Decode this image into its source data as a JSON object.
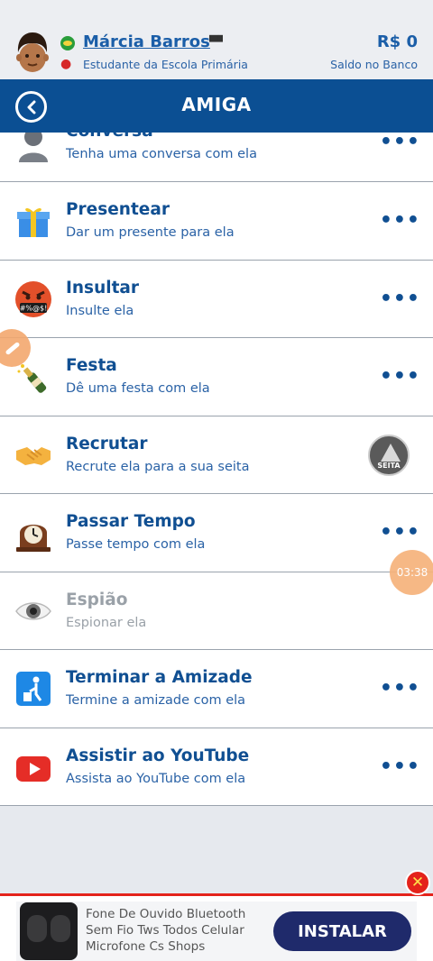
{
  "header": {
    "name": "Márcia Barros",
    "role": "Estudante da Escola Primária",
    "money": "R$ 0",
    "money_label": "Saldo no Banco"
  },
  "titlebar": {
    "title": "AMIGA"
  },
  "items": [
    {
      "title": "Conversa",
      "subtitle": "Tenha uma conversa com ela",
      "icon": "person-silhouette-icon",
      "more": "•••"
    },
    {
      "title": "Presentear",
      "subtitle": "Dar um presente para ela",
      "icon": "gift-icon",
      "more": "•••"
    },
    {
      "title": "Insultar",
      "subtitle": "Insulte ela",
      "icon": "angry-face-icon",
      "more": "•••"
    },
    {
      "title": "Festa",
      "subtitle": "Dê uma festa com ela",
      "icon": "champagne-icon",
      "more": "•••"
    },
    {
      "title": "Recrutar",
      "subtitle": "Recrute ela para a sua seita",
      "icon": "handshake-icon",
      "badge": "SEITA"
    },
    {
      "title": "Passar Tempo",
      "subtitle": "Passe tempo com ela",
      "icon": "clock-icon",
      "more": "•••"
    },
    {
      "title": "Espião",
      "subtitle": "Espionar ela",
      "icon": "eye-icon"
    },
    {
      "title": "Terminar a Amizade",
      "subtitle": "Termine a amizade com ela",
      "icon": "trash-person-icon",
      "more": "•••"
    },
    {
      "title": "Assistir ao YouTube",
      "subtitle": "Assista ao YouTube com ela",
      "icon": "youtube-icon",
      "more": "•••"
    }
  ],
  "overlay": {
    "timer": "03:38"
  },
  "ad": {
    "text": "Fone De Ouvido Bluetooth Sem Fio Tws Todos Celular Microfone Cs Shops",
    "button": "INSTALAR",
    "close": "✕"
  },
  "colors": {
    "brand_blue": "#0b4f93",
    "title_blue": "#104f92",
    "ad_button": "#1f2a6b",
    "ad_close": "#e4231b"
  }
}
